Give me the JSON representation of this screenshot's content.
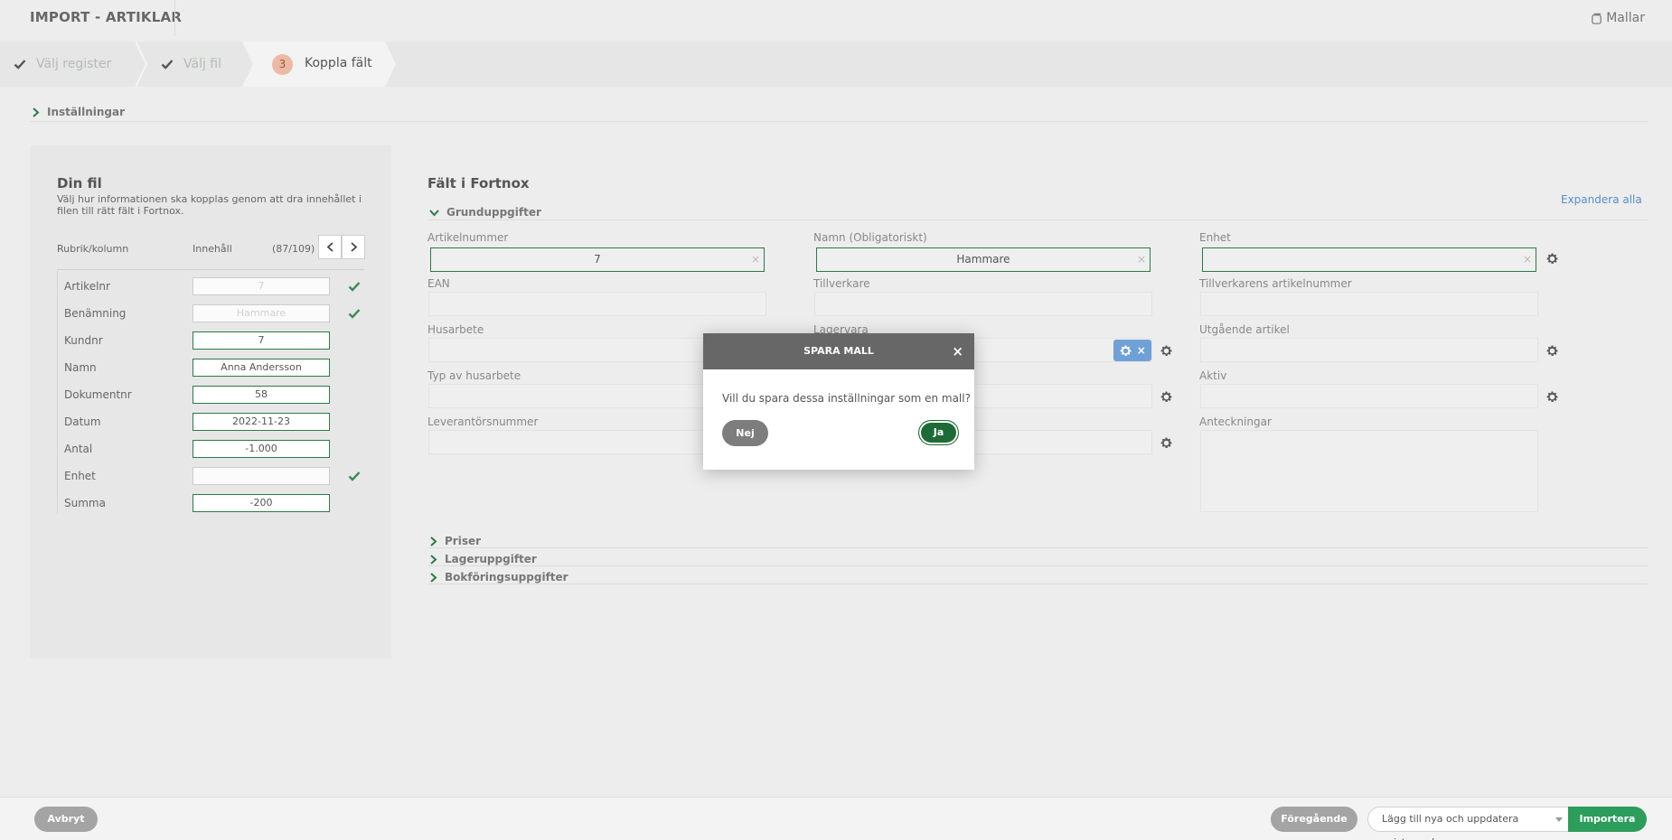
{
  "header": {
    "title": "IMPORT - ARTIKLAR",
    "templates_label": "Mallar"
  },
  "stepper": {
    "steps": [
      {
        "label": "Välj register",
        "state": "done"
      },
      {
        "label": "Välj fil",
        "state": "done"
      },
      {
        "number": "3",
        "label": "Koppla fält",
        "state": "active"
      }
    ]
  },
  "settings": {
    "label": "Inställningar"
  },
  "file_panel": {
    "title": "Din fil",
    "description": "Välj hur informationen ska kopplas genom att dra innehållet i filen till rätt fält i Fortnox.",
    "col_header": "Rubrik/kolumn",
    "col_content": "Innehåll",
    "count": "(87/109)",
    "rows": [
      {
        "label": "Artikelnr",
        "value": "7",
        "used": true
      },
      {
        "label": "Benämning",
        "value": "Hammare",
        "used": true
      },
      {
        "label": "Kundnr",
        "value": "7",
        "used": false
      },
      {
        "label": "Namn",
        "value": "Anna Andersson",
        "used": false
      },
      {
        "label": "Dokumentnr",
        "value": "58",
        "used": false
      },
      {
        "label": "Datum",
        "value": "2022-11-23",
        "used": false
      },
      {
        "label": "Antal",
        "value": "-1.000",
        "used": false
      },
      {
        "label": "Enhet",
        "value": "",
        "used": true
      },
      {
        "label": "Summa",
        "value": "-200",
        "used": false
      }
    ]
  },
  "fields_panel": {
    "title": "Fält i Fortnox",
    "expand_all": "Expandera alla",
    "group_basic": "Grunduppgifter",
    "fields": {
      "artikelnummer": {
        "label": "Artikelnummer",
        "value": "7"
      },
      "namn": {
        "label": "Namn (Obligatoriskt)",
        "value": "Hammare"
      },
      "enhet": {
        "label": "Enhet",
        "value": ""
      },
      "ean": {
        "label": "EAN",
        "value": ""
      },
      "tillverkare": {
        "label": "Tillverkare",
        "value": ""
      },
      "tillverkarens_artikelnummer": {
        "label": "Tillverkarens artikelnummer",
        "value": ""
      },
      "husarbete": {
        "label": "Husarbete",
        "value": ""
      },
      "lagervara": {
        "label": "Lagervara",
        "value": ""
      },
      "utgaende_artikel": {
        "label": "Utgående artikel",
        "value": ""
      },
      "typ_av_husarbete": {
        "label": "Typ av husarbete",
        "value": ""
      },
      "aktiv": {
        "label": "Aktiv",
        "value": ""
      },
      "leverantorsnummer": {
        "label": "Leverantörsnummer",
        "value": ""
      },
      "anteckningar": {
        "label": "Anteckningar",
        "value": ""
      }
    },
    "clear_glyph": "×",
    "groups_collapsed": [
      "Priser",
      "Lageruppgifter",
      "Bokföringsuppgifter"
    ]
  },
  "modal": {
    "title": "SPARA MALL",
    "close_glyph": "×",
    "message": "Vill du spara dessa inställningar som en mall?",
    "no_label": "Nej",
    "yes_label": "Ja"
  },
  "footer": {
    "cancel_label": "Avbryt",
    "previous_label": "Föregående",
    "mode_value": "Lägg till nya och uppdatera existerande",
    "import_label": "Importera"
  },
  "colors": {
    "accent_green": "#2c7a46",
    "import_green": "#2c9d5a",
    "step_badge": "#ecb9a4",
    "link_blue": "#5a8dc6"
  }
}
